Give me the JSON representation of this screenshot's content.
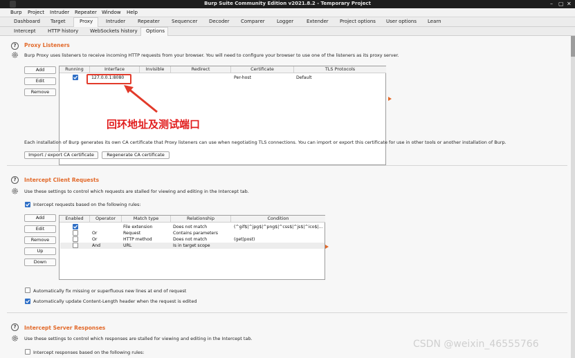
{
  "window": {
    "title": "Burp Suite Community Edition v2021.8.2 - Temporary Project",
    "controls": [
      "–",
      "▢",
      "✕"
    ]
  },
  "menu": [
    "Burp",
    "Project",
    "Intruder",
    "Repeater",
    "Window",
    "Help"
  ],
  "main_tabs": [
    "Dashboard",
    "Target",
    "Proxy",
    "Intruder",
    "Repeater",
    "Sequencer",
    "Decoder",
    "Comparer",
    "Logger",
    "Extender",
    "Project options",
    "User options",
    "Learn"
  ],
  "main_tabs_active": "Proxy",
  "sub_tabs": [
    "Intercept",
    "HTTP history",
    "WebSockets history",
    "Options"
  ],
  "sub_tabs_active": "Options",
  "proxy_listeners": {
    "title": "Proxy Listeners",
    "description": "Burp Proxy uses listeners to receive incoming HTTP requests from your browser. You will need to configure your browser to use one of the listeners as its proxy server.",
    "buttons": {
      "add": "Add",
      "edit": "Edit",
      "remove": "Remove"
    },
    "columns": [
      "Running",
      "Interface",
      "Invisible",
      "Redirect",
      "Certificate",
      "TLS Protocols"
    ],
    "rows": [
      {
        "running": true,
        "interface": "127.0.0.1:8080",
        "invisible": "",
        "redirect": "",
        "certificate": "Per-host",
        "tls": "Default"
      }
    ],
    "ca_text": "Each installation of Burp generates its own CA certificate that Proxy listeners can use when negotiating TLS connections. You can import or export this certificate for use in other tools or another installation of Burp.",
    "import_export_btn": "Import / export CA certificate",
    "regenerate_btn": "Regenerate CA certificate"
  },
  "annotation": {
    "text": "回环地址及测试端口",
    "color": "#e11d1d"
  },
  "intercept_client": {
    "title": "Intercept Client Requests",
    "description": "Use these settings to control which requests are stalled for viewing and editing in the Intercept tab.",
    "checkbox_label": "Intercept requests based on the following rules:",
    "buttons": {
      "add": "Add",
      "edit": "Edit",
      "remove": "Remove",
      "up": "Up",
      "down": "Down"
    },
    "columns": [
      "Enabled",
      "Operator",
      "Match type",
      "Relationship",
      "Condition"
    ],
    "rows": [
      {
        "enabled": true,
        "operator": "",
        "match_type": "File extension",
        "relationship": "Does not match",
        "condition": "(^gif$|^jpg$|^png$|^css$|^js$|^ico$|..."
      },
      {
        "enabled": false,
        "operator": "Or",
        "match_type": "Request",
        "relationship": "Contains parameters",
        "condition": ""
      },
      {
        "enabled": false,
        "operator": "Or",
        "match_type": "HTTP method",
        "relationship": "Does not match",
        "condition": "(get|post)"
      },
      {
        "enabled": false,
        "operator": "And",
        "match_type": "URL",
        "relationship": "Is in target scope",
        "condition": ""
      }
    ],
    "opt_fix_newlines": "Automatically fix missing or superfluous new lines at end of request",
    "opt_update_length": "Automatically update Content-Length header when the request is edited"
  },
  "intercept_server": {
    "title": "Intercept Server Responses",
    "description": "Use these settings to control which responses are stalled for viewing and editing in the Intercept tab.",
    "checkbox_label": "Intercept responses based on the following rules:"
  },
  "watermark": "CSDN @weixin_46555766",
  "colors": {
    "accent": "#e2692a",
    "checkbox": "#2f6fc6",
    "titlebar": "#1e1e1e"
  }
}
